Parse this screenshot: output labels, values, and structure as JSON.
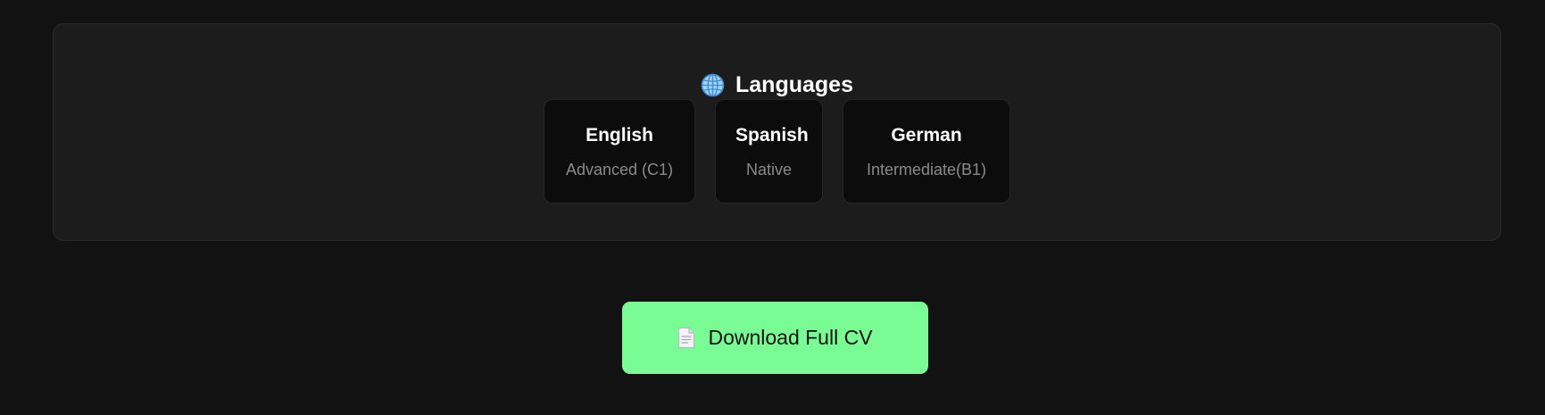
{
  "languages": {
    "title": "Languages",
    "title_icon": "globe-icon",
    "items": [
      {
        "language": "English",
        "level": "Advanced (C1)"
      },
      {
        "language": "Spanish",
        "level": "Native"
      },
      {
        "language": "German",
        "level": "Intermediate(B1)"
      }
    ]
  },
  "download": {
    "label": "Download Full CV",
    "icon": "document-icon"
  },
  "colors": {
    "background": "#121212",
    "section": "#1c1c1c",
    "card": "#0c0c0c",
    "accent": "#7afc94",
    "muted_text": "#8a8a8a"
  }
}
